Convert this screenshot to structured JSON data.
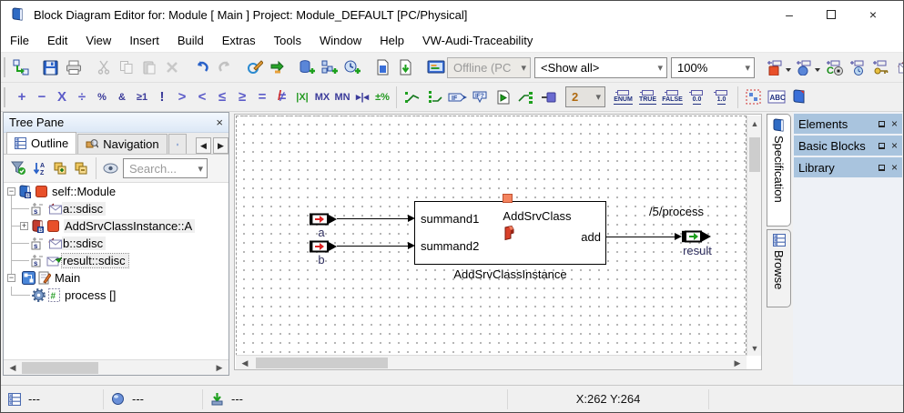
{
  "window": {
    "title": "Block Diagram Editor for: Module [ Main ] Project: Module_DEFAULT [PC/Physical]",
    "minimize": "–",
    "close": "×"
  },
  "menu": {
    "items": [
      "File",
      "Edit",
      "View",
      "Insert",
      "Build",
      "Extras",
      "Tools",
      "Window",
      "Help",
      "VW-Audi-Traceability"
    ]
  },
  "toolbar1": {
    "offline_select": "Offline (PC",
    "show_all_select": "<Show all>",
    "zoom_select": "100%"
  },
  "toolbar2": {
    "operators": [
      "+",
      "−",
      "X",
      "÷",
      "%",
      "&",
      "≥1",
      "!",
      ">",
      "<",
      "≤",
      "≥",
      "=",
      "≠"
    ],
    "abs": "|X|",
    "max": "MX",
    "min": "MN",
    "limit": "▸|◂",
    "mod": "±%",
    "if_label": "IF",
    "ifelse_label": "IF?",
    "count_select": "2",
    "literals": [
      "ENUM",
      "TRUE",
      "FALSE",
      "0.0",
      "1.0"
    ],
    "abc": "ABC"
  },
  "tree_pane": {
    "title": "Tree Pane",
    "close": "×",
    "tabs": {
      "outline": "Outline",
      "navigation": "Navigation"
    },
    "search_placeholder": "Search...",
    "items": {
      "root": "self::Module",
      "a": "a::sdisc",
      "instance": "AddSrvClassInstance::A",
      "b": "b::sdisc",
      "result": "result::sdisc",
      "main": "Main",
      "process": "process []"
    }
  },
  "canvas": {
    "block": {
      "name": "AddSrvClass",
      "instance": "AddSrvClassInstance",
      "input1": "summand1",
      "input2": "summand2",
      "output": "add"
    },
    "port_a": "a",
    "port_b": "b",
    "port_result": "result",
    "annotation": "/5/process"
  },
  "right": {
    "tabs": {
      "specification": "Specification",
      "browse": "Browse"
    },
    "panels": {
      "elements": "Elements",
      "basic_blocks": "Basic Blocks",
      "library": "Library"
    }
  },
  "status": {
    "seg1": "---",
    "seg2": "---",
    "seg3": "---",
    "coords": "X:262 Y:264"
  }
}
